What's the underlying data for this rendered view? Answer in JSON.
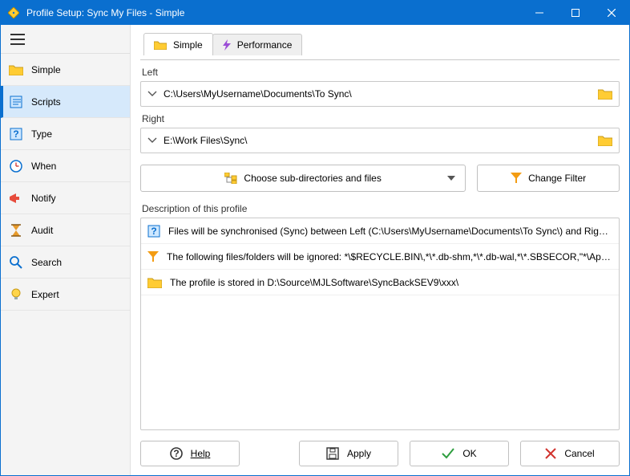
{
  "titlebar": {
    "title": "Profile Setup: Sync My Files - Simple"
  },
  "sidebar": {
    "items": [
      {
        "label": "Simple"
      },
      {
        "label": "Scripts"
      },
      {
        "label": "Type"
      },
      {
        "label": "When"
      },
      {
        "label": "Notify"
      },
      {
        "label": "Audit"
      },
      {
        "label": "Search"
      },
      {
        "label": "Expert"
      }
    ]
  },
  "tabs": {
    "items": [
      {
        "label": "Simple"
      },
      {
        "label": "Performance"
      }
    ]
  },
  "main": {
    "left_label": "Left",
    "left_path": "C:\\Users\\MyUsername\\Documents\\To Sync\\",
    "right_label": "Right",
    "right_path": "E:\\Work Files\\Sync\\",
    "choose_button": "Choose sub-directories and files",
    "filter_button": "Change Filter",
    "desc_label": "Description of this profile",
    "desc_items": [
      "Files will be synchronised (Sync) between Left (C:\\Users\\MyUsername\\Documents\\To Sync\\) and Right (E:\\...",
      "The following files/folders will be ignored: *\\$RECYCLE.BIN\\,*\\*.db-shm,*\\*.db-wal,*\\*.SBSECOR,\"*\\AppData...",
      "The profile is stored in D:\\Source\\MJLSoftware\\SyncBackSEV9\\xxx\\"
    ]
  },
  "footer": {
    "help": "Help",
    "apply": "Apply",
    "ok": "OK",
    "cancel": "Cancel"
  },
  "colors": {
    "accent": "#0a6fcf",
    "folder": "#ffcc33"
  }
}
